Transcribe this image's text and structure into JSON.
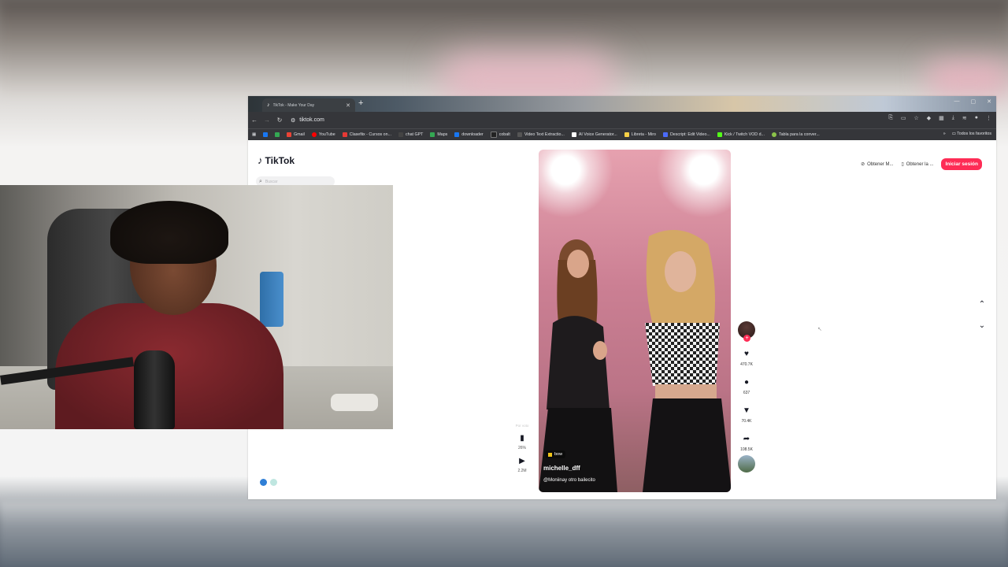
{
  "browser": {
    "tab_title": "TikTok - Make Your Day",
    "url": "tiktok.com",
    "bookmarks": [
      {
        "label": "Gmail",
        "color": "#ea4335"
      },
      {
        "label": "YouTube",
        "color": "#ff0000"
      },
      {
        "label": "Clasefiix - Cursos on...",
        "color": "#e53935"
      },
      {
        "label": "chat GPT",
        "color": "#444444"
      },
      {
        "label": "Maps",
        "color": "#34a853"
      },
      {
        "label": "downloader",
        "color": "#1877f2"
      },
      {
        "label": "cobalt",
        "color": "#222222"
      },
      {
        "label": "Video Text Extractio...",
        "color": "#555555"
      },
      {
        "label": "AI Voice Generator...",
        "color": "#ffffff"
      },
      {
        "label": "Libreta - Miro",
        "color": "#f7d046"
      },
      {
        "label": "Descript: Edit Video...",
        "color": "#4b6bfb"
      },
      {
        "label": "Kick / Twitch VOD d...",
        "color": "#53fc18"
      },
      {
        "label": "Tabla para la conver...",
        "color": "#8bc34a"
      }
    ],
    "all_bookmarks": "Todos los favoritos"
  },
  "tiktok": {
    "logo_text": "TikTok",
    "search_placeholder": "Buscar",
    "actions": {
      "get_coins": "Obtener M...",
      "get_app": "Obtener la ...",
      "login": "Iniciar sesión"
    },
    "video": {
      "tag": "bow",
      "username": "michelle_dff",
      "caption": "@Moniinay otro bailecito"
    },
    "rail": {
      "likes": "470.7K",
      "comments": "637",
      "saves": "70.4K",
      "shares": "108.5K"
    },
    "left_stats": {
      "label": "Por voto",
      "percent": "26%",
      "plays": "2.2M"
    }
  },
  "colors": {
    "accent": "#fe2c55"
  }
}
